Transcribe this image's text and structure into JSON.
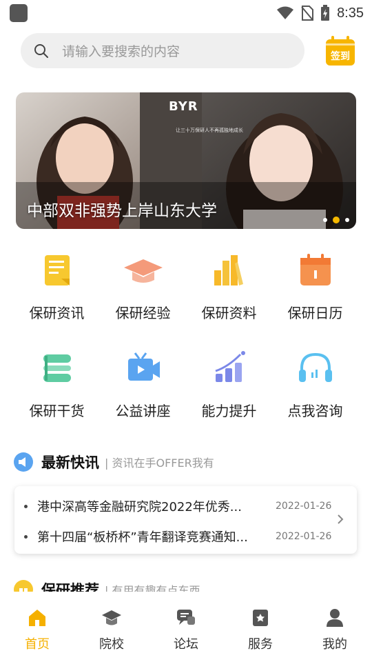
{
  "status": {
    "time": "8:35"
  },
  "search": {
    "placeholder": "请输入要搜索的内容"
  },
  "checkin": {
    "label": "签到",
    "color": "#f7b500"
  },
  "banner": {
    "title": "中部双非强势上岸山东大学",
    "logo": "BYR",
    "tagline": "让三十万保研人不再孤独地成长",
    "dots": 3,
    "active_dot": 2
  },
  "grid": [
    {
      "label": "保研资讯",
      "icon": "news-doc-icon",
      "color": "#f7c82f"
    },
    {
      "label": "保研经验",
      "icon": "graduation-cap-icon",
      "color": "#f49a7a"
    },
    {
      "label": "保研资料",
      "icon": "books-icon",
      "color": "#f7b92a"
    },
    {
      "label": "保研日历",
      "icon": "calendar-icon",
      "color": "#f5924e"
    },
    {
      "label": "保研干货",
      "icon": "dry-goods-icon",
      "color": "#5fcca2"
    },
    {
      "label": "公益讲座",
      "icon": "video-lecture-icon",
      "color": "#5aa4f0"
    },
    {
      "label": "能力提升",
      "icon": "growth-chart-icon",
      "color": "#7b88e8"
    },
    {
      "label": "点我咨询",
      "icon": "headset-icon",
      "color": "#5ac0f0"
    }
  ],
  "news": {
    "title": "最新快讯",
    "subtitle": "资讯在手OFFER我有",
    "items": [
      {
        "text": "港中深高等金融研究院2022年优秀...",
        "date": "2022-01-26"
      },
      {
        "text": "第十四届“板桥杯”青年翻译竞赛通知...",
        "date": "2022-01-26"
      }
    ]
  },
  "recommend": {
    "title": "保研推荐",
    "subtitle": "有用有趣有点东西"
  },
  "nav": {
    "items": [
      {
        "label": "首页",
        "icon": "home-icon",
        "active": true
      },
      {
        "label": "院校",
        "icon": "school-icon",
        "active": false
      },
      {
        "label": "论坛",
        "icon": "forum-icon",
        "active": false
      },
      {
        "label": "服务",
        "icon": "service-icon",
        "active": false
      },
      {
        "label": "我的",
        "icon": "profile-icon",
        "active": false
      }
    ],
    "active_color": "#f5b000",
    "inactive_color": "#555555"
  }
}
